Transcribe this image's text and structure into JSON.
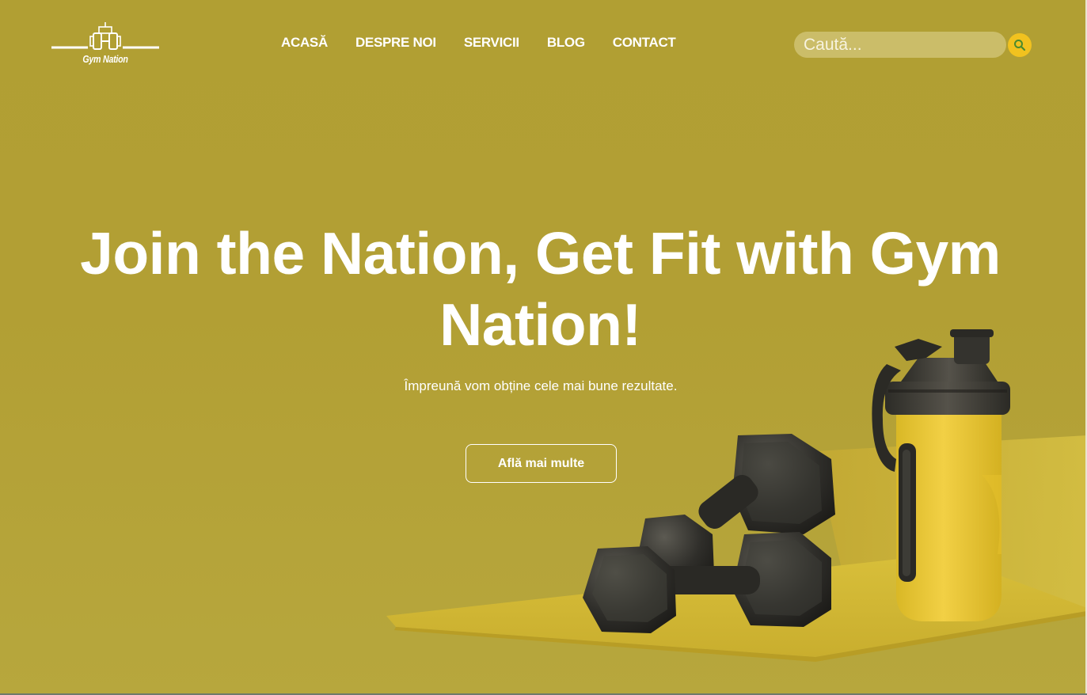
{
  "brand": {
    "name": "Gym Nation"
  },
  "nav": {
    "items": [
      {
        "label": "ACASĂ"
      },
      {
        "label": "DESPRE NOI"
      },
      {
        "label": "SERVICII"
      },
      {
        "label": "BLOG"
      },
      {
        "label": "CONTACT"
      }
    ]
  },
  "search": {
    "placeholder": "Caută...",
    "value": "",
    "button_icon": "search-icon"
  },
  "hero": {
    "title": "Join the Nation, Get Fit with Gym Nation!",
    "subtitle": "Împreună vom obține cele mai bune rezultate.",
    "cta_label": "Află mai multe",
    "image": "dumbbells-and-shaker-bottle"
  },
  "colors": {
    "background": "#b19f33",
    "accent": "#f1c21f",
    "text": "#ffffff"
  }
}
